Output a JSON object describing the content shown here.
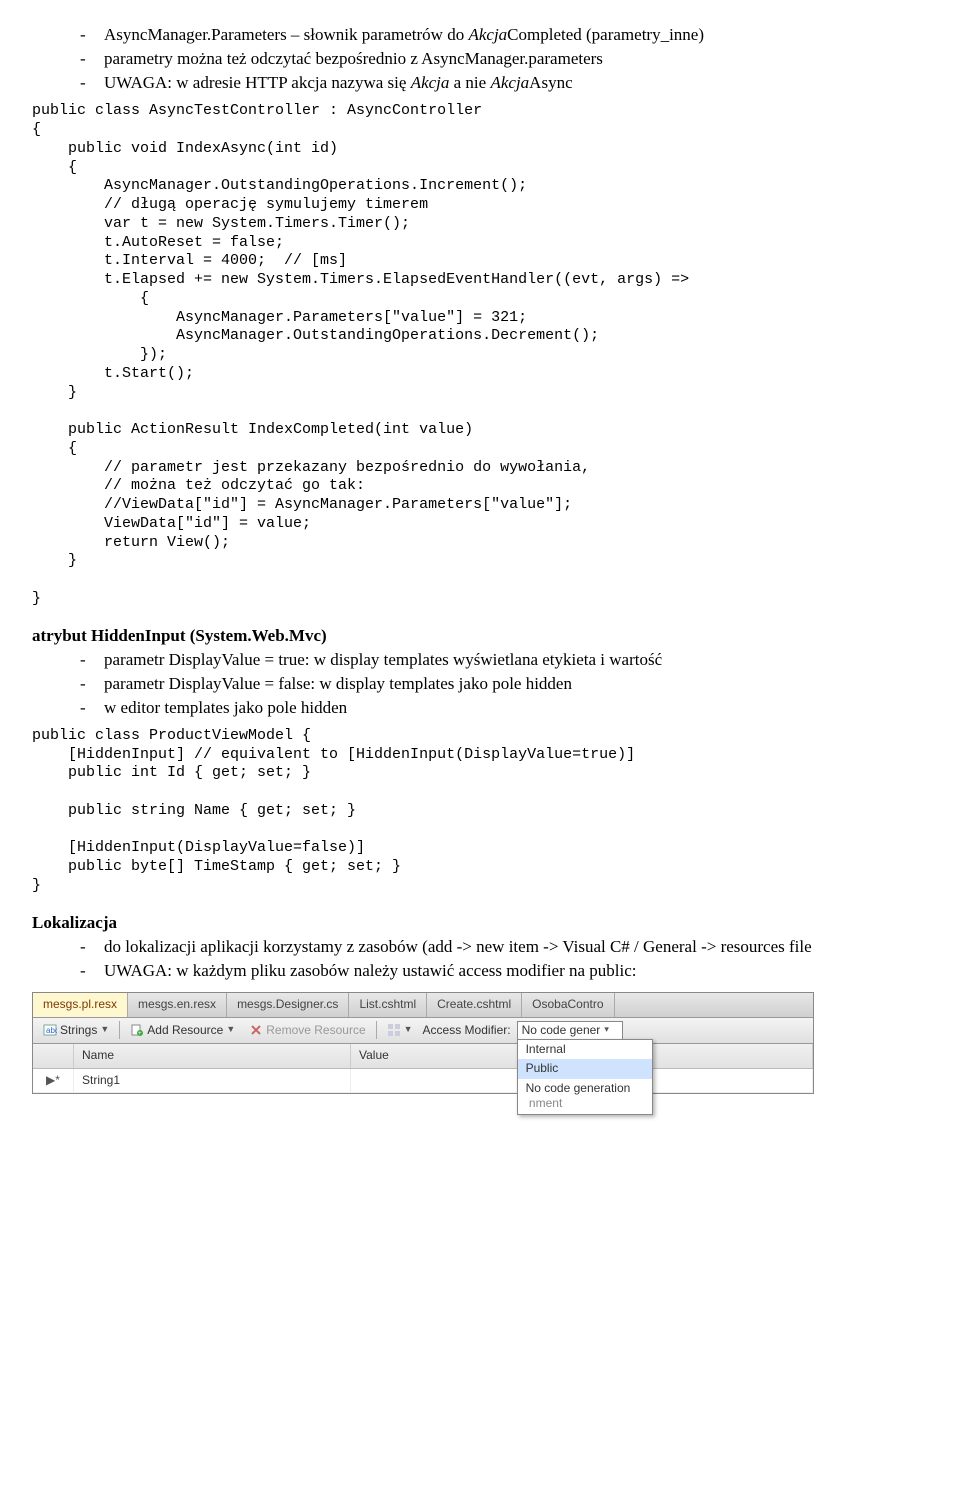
{
  "intro_bullets": [
    {
      "pre": "AsyncManager.Parameters – słownik parametrów do ",
      "it1": "Akcja",
      "mid": "Completed (parametry_inne)"
    },
    {
      "pre": "parametry można też odczytać bezpośrednio z AsyncManager.parameters"
    },
    {
      "pre": "UWAGA: w adresie HTTP akcja nazywa się ",
      "it1": "Akcja",
      "mid": " a nie ",
      "it2": "Akcja",
      "post": "Async"
    }
  ],
  "code1": "public class AsyncTestController : AsyncController\n{\n    public void IndexAsync(int id)\n    {\n        AsyncManager.OutstandingOperations.Increment();\n        // długą operację symulujemy timerem\n        var t = new System.Timers.Timer();\n        t.AutoReset = false;\n        t.Interval = 4000;  // [ms]\n        t.Elapsed += new System.Timers.ElapsedEventHandler((evt, args) =>\n            {\n                AsyncManager.Parameters[\"value\"] = 321;\n                AsyncManager.OutstandingOperations.Decrement();\n            });\n        t.Start();\n    }\n\n    public ActionResult IndexCompleted(int value)\n    {\n        // parametr jest przekazany bezpośrednio do wywołania,\n        // można też odczytać go tak:\n        //ViewData[\"id\"] = AsyncManager.Parameters[\"value\"];\n        ViewData[\"id\"] = value;\n        return View();\n    }\n\n}",
  "hidden_title": "atrybut HiddenInput (System.Web.Mvc)",
  "hidden_bullets": [
    "parametr DisplayValue = true: w display templates wyświetlana etykieta i wartość",
    "parametr DisplayValue = false: w display templates jako pole hidden",
    "w editor templates jako pole hidden"
  ],
  "code2": "public class ProductViewModel {\n    [HiddenInput] // equivalent to [HiddenInput(DisplayValue=true)]\n    public int Id { get; set; }\n\n    public string Name { get; set; }\n\n    [HiddenInput(DisplayValue=false)]\n    public byte[] TimeStamp { get; set; }\n}",
  "loc_title": "Lokalizacja",
  "loc_bullets": [
    "do lokalizacji aplikacji korzystamy z zasobów (add -> new item -> Visual C# / General -> resources file",
    "UWAGA: w każdym pliku zasobów należy ustawić access modifier na public:"
  ],
  "screenshot": {
    "tabs": [
      "mesgs.pl.resx",
      "mesgs.en.resx",
      "mesgs.Designer.cs",
      "List.cshtml",
      "Create.cshtml",
      "OsobaContro"
    ],
    "active_tab_index": 0,
    "toolbar": {
      "strings": "Strings",
      "add_resource": "Add Resource",
      "remove_resource": "Remove Resource",
      "access_modifier_label": "Access Modifier:",
      "access_modifier_value": "No code gener"
    },
    "popup_items": [
      "Internal",
      "Public",
      "No code generation"
    ],
    "popup_selected_index": 1,
    "popup_trailing": "nment",
    "grid_headers": [
      "",
      "Name",
      "Value"
    ],
    "grid_row": {
      "marker": "▶*",
      "name": "String1",
      "value": ""
    }
  }
}
